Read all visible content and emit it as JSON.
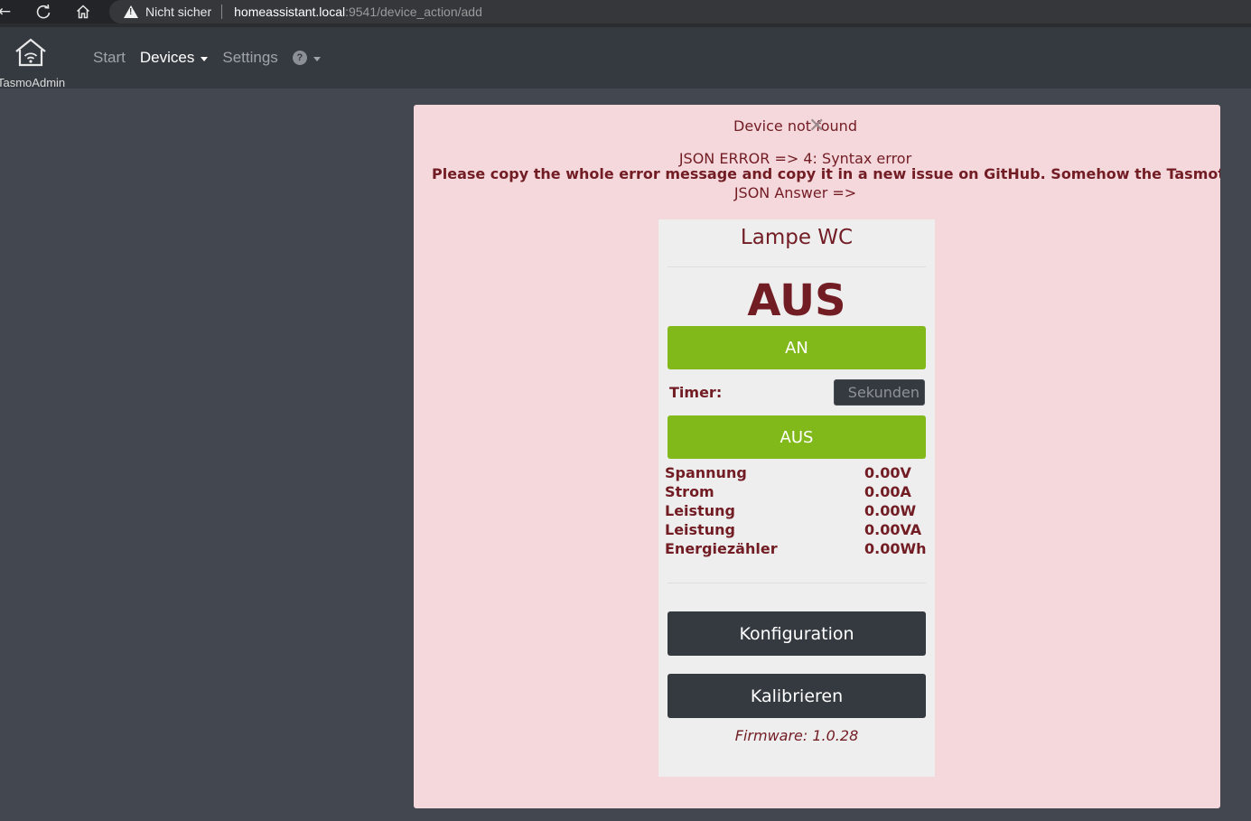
{
  "browser": {
    "security_label": "Nicht sicher",
    "url_host": "homeassistant.local",
    "url_path": ":9541/device_action/add"
  },
  "app": {
    "logo_text": "TasmoAdmin",
    "nav": {
      "start": "Start",
      "devices": "Devices",
      "settings": "Settings",
      "help": "?"
    }
  },
  "alert": {
    "title": "Device not found",
    "json_error": "JSON ERROR => 4: Syntax error",
    "copy_message": "Please copy the whole error message and copy it in a new issue on GitHub. Somehow the Tasmota Fi",
    "json_answer": "JSON Answer =>"
  },
  "device": {
    "name": "Lampe WC",
    "state": "AUS",
    "on_button": "AN",
    "timer_label": "Timer:",
    "timer_placeholder": "Sekunden",
    "off_button": "AUS",
    "sensors": [
      {
        "name": "Spannung",
        "value": "0.00V"
      },
      {
        "name": "Strom",
        "value": "0.00A"
      },
      {
        "name": "Leistung",
        "value": "0.00W"
      },
      {
        "name": "Leistung",
        "value": "0.00VA"
      },
      {
        "name": "Energiezähler",
        "value": "0.00Wh"
      }
    ],
    "config_button": "Konfiguration",
    "calibrate_button": "Kalibrieren",
    "firmware": "Firmware: 1.0.28"
  },
  "colors": {
    "page_bg": "#434850",
    "nav_bg": "#353a40",
    "alert_bg": "#f5d8dc",
    "alert_text": "#721c24",
    "card_bg": "#eeeeee",
    "green": "#82b91a",
    "dark_button": "#353a40"
  }
}
